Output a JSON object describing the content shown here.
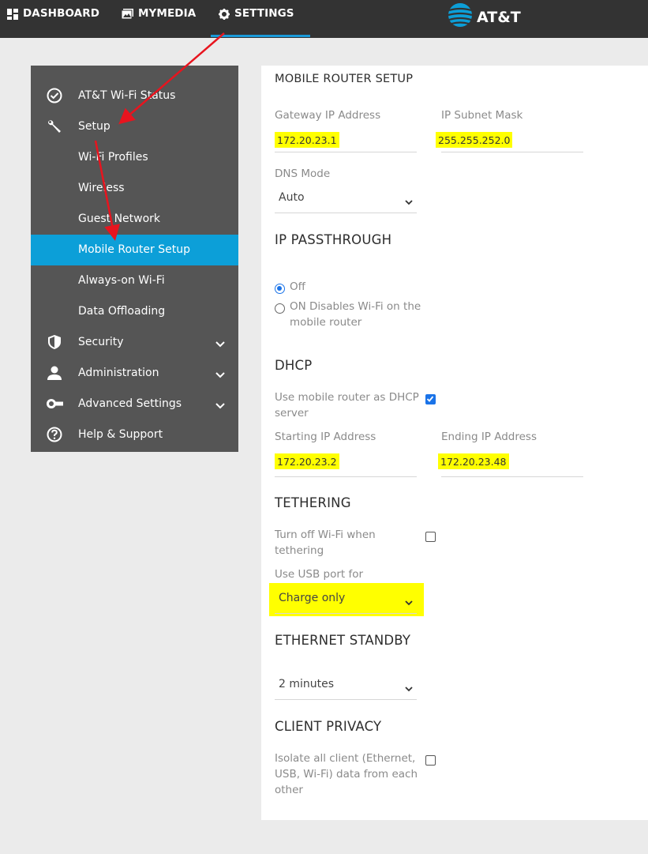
{
  "topnav": {
    "dashboard": "DASHBOARD",
    "mymedia": "MYMEDIA",
    "settings": "SETTINGS",
    "brand": "AT&T"
  },
  "sidebar": {
    "items": [
      {
        "label": "AT&T Wi-Fi Status",
        "icon": "check-circle-icon"
      },
      {
        "label": "Setup",
        "icon": "wrench-icon"
      },
      {
        "label": "Wi-Fi Profiles"
      },
      {
        "label": "Wireless"
      },
      {
        "label": "Guest Network"
      },
      {
        "label": "Mobile Router Setup",
        "active": true
      },
      {
        "label": "Always-on Wi-Fi"
      },
      {
        "label": "Data Offloading"
      },
      {
        "label": "Security",
        "icon": "shield-icon"
      },
      {
        "label": "Administration",
        "icon": "person-icon"
      },
      {
        "label": "Advanced Settings",
        "icon": "toggle-icon"
      },
      {
        "label": "Help & Support",
        "icon": "help-icon"
      }
    ]
  },
  "main": {
    "mobile_router_setup": {
      "title": "MOBILE ROUTER SETUP",
      "gateway_label": "Gateway IP Address",
      "gateway_value": "172.20.23.1",
      "subnet_label": "IP Subnet Mask",
      "subnet_value": "255.255.252.0",
      "dns_label": "DNS Mode",
      "dns_value": "Auto"
    },
    "ip_passthrough": {
      "title": "IP PASSTHROUGH",
      "off_label": "Off",
      "on_label_line1": "ON Disables Wi-Fi on the",
      "on_label_line2": "mobile router"
    },
    "dhcp": {
      "title": "DHCP",
      "use_label_line1": "Use mobile router as DHCP",
      "use_label_line2": "server",
      "start_label": "Starting IP Address",
      "start_value": "172.20.23.2",
      "end_label": "Ending IP Address",
      "end_value": "172.20.23.48"
    },
    "tethering": {
      "title": "TETHERING",
      "wifi_off_line1": "Turn off Wi-Fi when",
      "wifi_off_line2": "tethering",
      "usb_label": "Use USB port for",
      "usb_value": "Charge only"
    },
    "ethernet_standby": {
      "title": "ETHERNET STANDBY",
      "value": "2 minutes"
    },
    "client_privacy": {
      "title": "CLIENT PRIVACY",
      "line1": "Isolate all client (Ethernet,",
      "line2": "USB, Wi-Fi) data from each",
      "line3": "other"
    }
  },
  "colors": {
    "topbar": "#333333",
    "sidebar": "#555555",
    "active": "#0c9fd8",
    "highlight": "#ffff00",
    "annotation_arrow": "#e8141e",
    "checkbox": "#1a73e8"
  }
}
